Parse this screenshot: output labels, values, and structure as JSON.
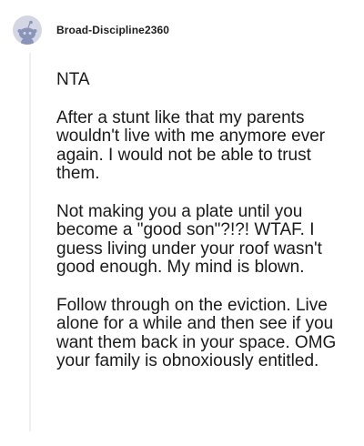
{
  "comment": {
    "author": "Broad-Discipline2360",
    "avatar_icon": "reddit-snoo-avatar-icon",
    "paragraphs": [
      "NTA",
      "After a stunt like that my parents wouldn't live with me anymore ever again. I would not be able to trust them.",
      "Not making you a plate until you become a \"good son\"?!?! WTAF. I guess living under your roof wasn't good enough. My mind is blown.",
      "Follow through on the eviction. Live alone for a while and then see if you want them back in your space. OMG your family is obnoxiously entitled."
    ]
  },
  "colors": {
    "avatar_bg": "#d4d7e3",
    "snoo": "#8a93b8",
    "text": "#1a1a1b",
    "thread_line": "#edeff1"
  }
}
